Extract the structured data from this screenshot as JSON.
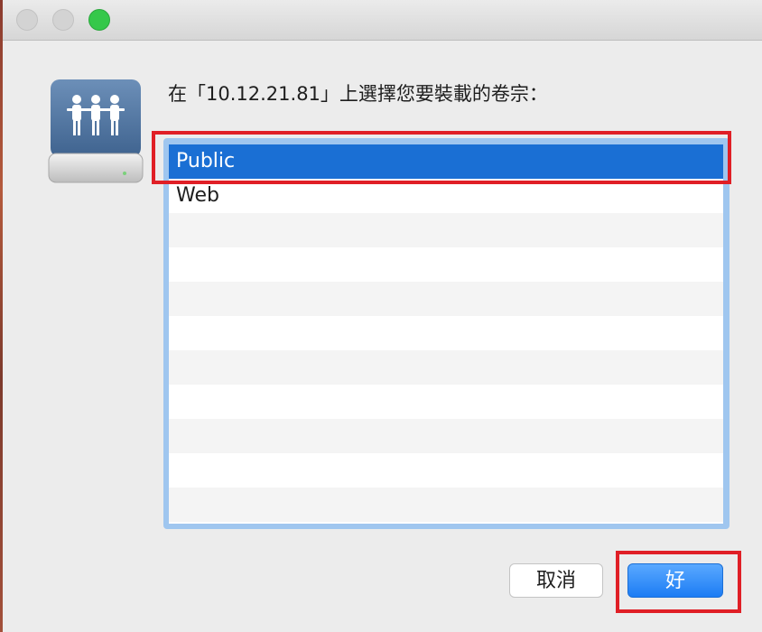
{
  "dialog": {
    "prompt": "在「10.12.21.81」上選擇您要裝載的卷宗："
  },
  "volumes": {
    "items": [
      "Public",
      "Web"
    ],
    "selected": "Public"
  },
  "buttons": {
    "cancel_label": "取消",
    "ok_label": "好"
  },
  "colors": {
    "selection": "#1a6fd4",
    "highlight": "#e01f26",
    "zoom_button": "#35c84a",
    "primary_button": "#1c7cf4"
  },
  "icons": {
    "window_close": "close-icon",
    "window_minimize": "minimize-icon",
    "window_zoom": "zoom-icon",
    "server": "shared-server-drive-icon"
  }
}
